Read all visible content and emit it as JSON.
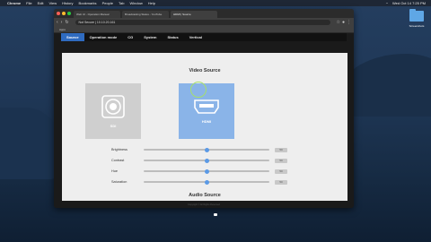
{
  "menubar": {
    "app": "Chrome",
    "items": [
      "File",
      "Edit",
      "View",
      "History",
      "Bookmarks",
      "People",
      "Tab",
      "Window",
      "Help"
    ],
    "clock": "Wed Oct 14  7:25 PM"
  },
  "desktop": {
    "folder_label": "Screenshots"
  },
  "browser": {
    "tabs": [
      {
        "label": "Web UI - Operation Manual"
      },
      {
        "label": "Broadcasting Status - YouTube"
      },
      {
        "label": "HDMI | Source"
      }
    ],
    "address": "Not Secure  |  10.10.20.161",
    "bookmarks_label": "Apps"
  },
  "nav": {
    "tabs": [
      "Source",
      "Operation mode",
      "CG",
      "System",
      "Status",
      "Vertical"
    ],
    "active": "Source"
  },
  "video_source": {
    "title": "Video Source",
    "options": [
      {
        "label": "SDI",
        "icon": "sdi-connector-icon"
      },
      {
        "label": "HDMI",
        "icon": "hdmi-connector-icon",
        "selected": true
      }
    ]
  },
  "adjustments": [
    {
      "label": "Brightness",
      "value": 50,
      "display": "50"
    },
    {
      "label": "Contrast",
      "value": 50,
      "display": "50"
    },
    {
      "label": "Hue",
      "value": 50,
      "display": "50"
    },
    {
      "label": "Saturation",
      "value": 50,
      "display": "50"
    }
  ],
  "audio_source": {
    "title": "Audio Source"
  },
  "footer": {
    "text": "Copyright © All Rights Reserved"
  },
  "colors": {
    "accent": "#2f6bc0",
    "selected_card": "#8ab4e8",
    "slider_thumb": "#5b9ae6"
  }
}
